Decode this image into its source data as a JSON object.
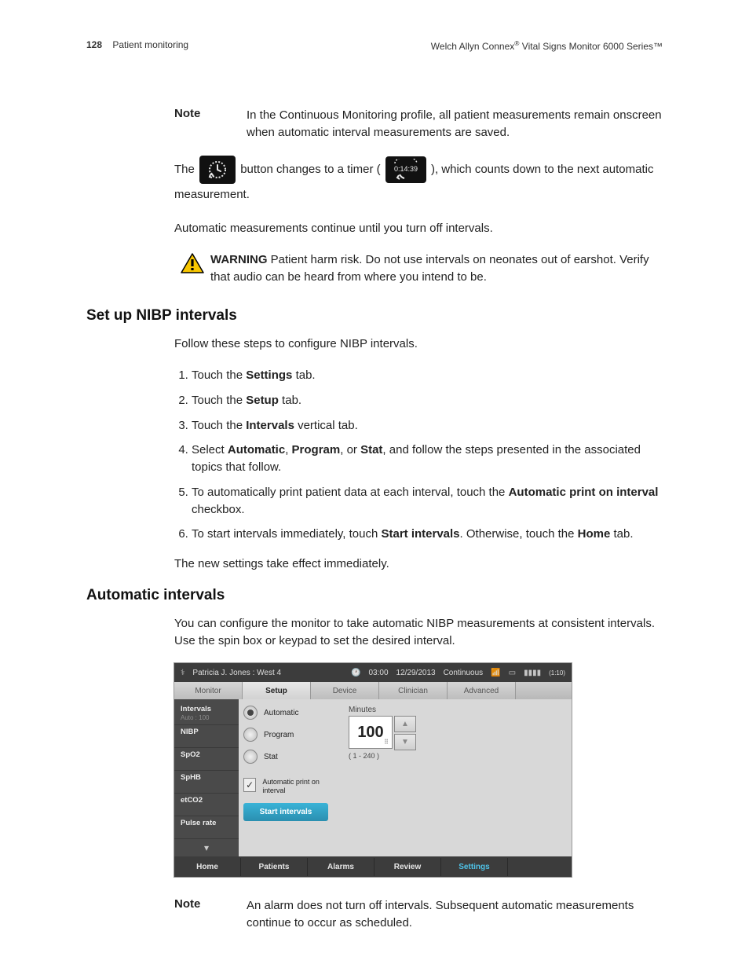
{
  "header": {
    "page_num": "128",
    "section": "Patient monitoring",
    "doc_title_a": "Welch Allyn Connex",
    "doc_title_b": " Vital Signs Monitor 6000 Series™"
  },
  "note1": {
    "label": "Note",
    "text": "In the Continuous Monitoring profile, all patient measurements remain onscreen when automatic interval measurements are saved."
  },
  "timerline": {
    "pre": "The ",
    "mid": " button changes to a timer ( ",
    "timer_value": "0:14:39",
    "post": " ), which counts down to the next automatic measurement."
  },
  "auto_cont": "Automatic measurements continue until you turn off intervals.",
  "warning": {
    "label": "WARNING",
    "text": "  Patient harm risk. Do not use intervals on neonates out of earshot. Verify that audio can be heard from where you intend to be."
  },
  "sec1": {
    "title": "Set up NIBP intervals",
    "intro": "Follow these steps to configure NIBP intervals.",
    "steps": {
      "s1a": "Touch the ",
      "s1b": "Settings",
      "s1c": " tab.",
      "s2a": "Touch the ",
      "s2b": "Setup",
      "s2c": " tab.",
      "s3a": "Touch the ",
      "s3b": "Intervals",
      "s3c": " vertical tab.",
      "s4a": "Select ",
      "s4b": "Automatic",
      "s4c": ", ",
      "s4d": "Program",
      "s4e": ", or ",
      "s4f": "Stat",
      "s4g": ", and follow the steps presented in the associated topics that follow.",
      "s5a": "To automatically print patient data at each interval, touch the ",
      "s5b": "Automatic print on interval",
      "s5c": " checkbox.",
      "s6a": "To start intervals immediately, touch ",
      "s6b": "Start intervals",
      "s6c": ". Otherwise, touch the ",
      "s6d": "Home",
      "s6e": " tab."
    },
    "outro": "The new settings take effect immediately."
  },
  "sec2": {
    "title": "Automatic intervals",
    "intro": "You can configure the monitor to take automatic NIBP measurements at consistent intervals. Use the spin box or keypad to set the desired interval."
  },
  "device": {
    "patient": "Patricia J. Jones : West 4",
    "time": "03:00",
    "date": "12/29/2013",
    "mode": "Continuous",
    "battery": "(1:10)",
    "tabs": [
      "Monitor",
      "Setup",
      "Device",
      "Clinician",
      "Advanced"
    ],
    "side": [
      {
        "t": "Intervals",
        "s": "Auto : 100"
      },
      {
        "t": "NIBP",
        "s": ""
      },
      {
        "t": "SpO2",
        "s": ""
      },
      {
        "t": "SpHB",
        "s": ""
      },
      {
        "t": "etCO2",
        "s": ""
      },
      {
        "t": "Pulse rate",
        "s": ""
      }
    ],
    "radios": [
      "Automatic",
      "Program",
      "Stat"
    ],
    "checkbox": "Automatic print on interval",
    "start": "Start intervals",
    "minutes_label": "Minutes",
    "minutes_value": "100",
    "minutes_range": "( 1 - 240 )",
    "bottom": [
      "Home",
      "Patients",
      "Alarms",
      "Review",
      "Settings"
    ]
  },
  "note2": {
    "label": "Note",
    "text": "An alarm does not turn off intervals. Subsequent automatic measurements continue to occur as scheduled."
  }
}
